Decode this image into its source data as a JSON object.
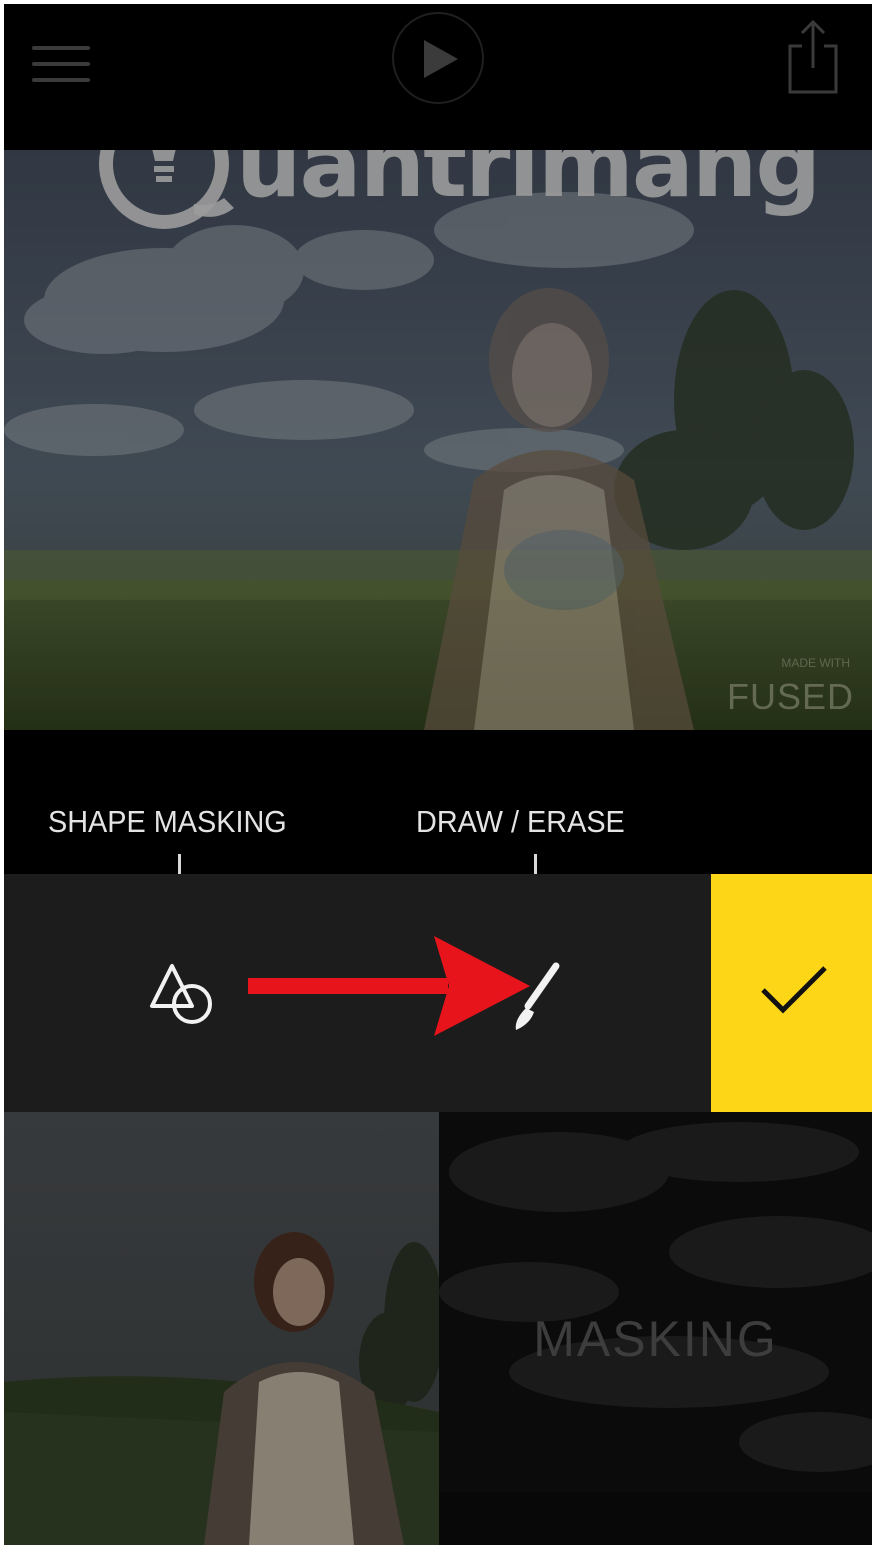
{
  "toolbar": {
    "shape_masking_label": "SHAPE MASKING",
    "draw_erase_label": "DRAW / ERASE"
  },
  "preview": {
    "watermark_text": "Quantrimang",
    "fused_label": "FUSED",
    "fused_small": "MADE WITH"
  },
  "bottom": {
    "masking_label": "MASKING"
  },
  "icons": {
    "menu": "hamburger-icon",
    "play": "play-icon",
    "share": "share-icon",
    "shape": "shapes-icon",
    "draw": "brush-icon",
    "confirm": "checkmark-icon",
    "annotation": "red-arrow"
  },
  "colors": {
    "confirm_button": "#fdd617",
    "annotation_arrow": "#e8141b",
    "toolbar_bg": "#1c1c1c"
  }
}
